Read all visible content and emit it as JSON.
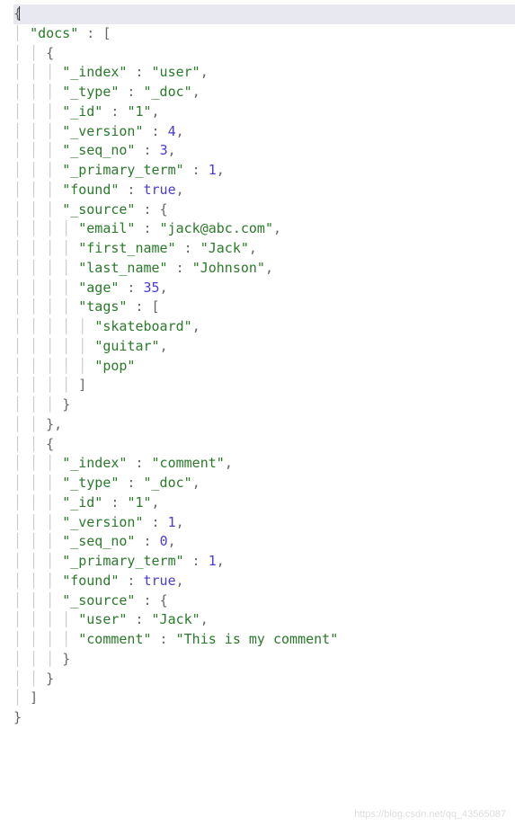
{
  "tokens": [
    [
      {
        "t": "{",
        "c": "brace",
        "hl": true,
        "cursor": true
      }
    ],
    [
      {
        "t": "  ",
        "c": "pad"
      },
      {
        "t": "\"docs\"",
        "c": "key"
      },
      {
        "t": " : ",
        "c": "punct"
      },
      {
        "t": "[",
        "c": "brace"
      }
    ],
    [
      {
        "t": "    ",
        "c": "pad"
      },
      {
        "t": "{",
        "c": "brace"
      }
    ],
    [
      {
        "t": "      ",
        "c": "pad"
      },
      {
        "t": "\"_index\"",
        "c": "key"
      },
      {
        "t": " : ",
        "c": "punct"
      },
      {
        "t": "\"user\"",
        "c": "str"
      },
      {
        "t": ",",
        "c": "punct"
      }
    ],
    [
      {
        "t": "      ",
        "c": "pad"
      },
      {
        "t": "\"_type\"",
        "c": "key"
      },
      {
        "t": " : ",
        "c": "punct"
      },
      {
        "t": "\"_doc\"",
        "c": "str"
      },
      {
        "t": ",",
        "c": "punct"
      }
    ],
    [
      {
        "t": "      ",
        "c": "pad"
      },
      {
        "t": "\"_id\"",
        "c": "key"
      },
      {
        "t": " : ",
        "c": "punct"
      },
      {
        "t": "\"1\"",
        "c": "str"
      },
      {
        "t": ",",
        "c": "punct"
      }
    ],
    [
      {
        "t": "      ",
        "c": "pad"
      },
      {
        "t": "\"_version\"",
        "c": "key"
      },
      {
        "t": " : ",
        "c": "punct"
      },
      {
        "t": "4",
        "c": "num"
      },
      {
        "t": ",",
        "c": "punct"
      }
    ],
    [
      {
        "t": "      ",
        "c": "pad"
      },
      {
        "t": "\"_seq_no\"",
        "c": "key"
      },
      {
        "t": " : ",
        "c": "punct"
      },
      {
        "t": "3",
        "c": "num"
      },
      {
        "t": ",",
        "c": "punct"
      }
    ],
    [
      {
        "t": "      ",
        "c": "pad"
      },
      {
        "t": "\"_primary_term\"",
        "c": "key"
      },
      {
        "t": " : ",
        "c": "punct"
      },
      {
        "t": "1",
        "c": "num"
      },
      {
        "t": ",",
        "c": "punct"
      }
    ],
    [
      {
        "t": "      ",
        "c": "pad"
      },
      {
        "t": "\"found\"",
        "c": "key"
      },
      {
        "t": " : ",
        "c": "punct"
      },
      {
        "t": "true",
        "c": "bool"
      },
      {
        "t": ",",
        "c": "punct"
      }
    ],
    [
      {
        "t": "      ",
        "c": "pad"
      },
      {
        "t": "\"_source\"",
        "c": "key"
      },
      {
        "t": " : ",
        "c": "punct"
      },
      {
        "t": "{",
        "c": "brace"
      }
    ],
    [
      {
        "t": "        ",
        "c": "pad"
      },
      {
        "t": "\"email\"",
        "c": "key"
      },
      {
        "t": " : ",
        "c": "punct"
      },
      {
        "t": "\"jack@abc.com\"",
        "c": "str"
      },
      {
        "t": ",",
        "c": "punct"
      }
    ],
    [
      {
        "t": "        ",
        "c": "pad"
      },
      {
        "t": "\"first_name\"",
        "c": "key"
      },
      {
        "t": " : ",
        "c": "punct"
      },
      {
        "t": "\"Jack\"",
        "c": "str"
      },
      {
        "t": ",",
        "c": "punct"
      }
    ],
    [
      {
        "t": "        ",
        "c": "pad"
      },
      {
        "t": "\"last_name\"",
        "c": "key"
      },
      {
        "t": " : ",
        "c": "punct"
      },
      {
        "t": "\"Johnson\"",
        "c": "str"
      },
      {
        "t": ",",
        "c": "punct"
      }
    ],
    [
      {
        "t": "        ",
        "c": "pad"
      },
      {
        "t": "\"age\"",
        "c": "key"
      },
      {
        "t": " : ",
        "c": "punct"
      },
      {
        "t": "35",
        "c": "num"
      },
      {
        "t": ",",
        "c": "punct"
      }
    ],
    [
      {
        "t": "        ",
        "c": "pad"
      },
      {
        "t": "\"tags\"",
        "c": "key"
      },
      {
        "t": " : ",
        "c": "punct"
      },
      {
        "t": "[",
        "c": "brace"
      }
    ],
    [
      {
        "t": "          ",
        "c": "pad"
      },
      {
        "t": "\"skateboard\"",
        "c": "str"
      },
      {
        "t": ",",
        "c": "punct"
      }
    ],
    [
      {
        "t": "          ",
        "c": "pad"
      },
      {
        "t": "\"guitar\"",
        "c": "str"
      },
      {
        "t": ",",
        "c": "punct"
      }
    ],
    [
      {
        "t": "          ",
        "c": "pad"
      },
      {
        "t": "\"pop\"",
        "c": "str"
      }
    ],
    [
      {
        "t": "        ",
        "c": "pad"
      },
      {
        "t": "]",
        "c": "brace"
      }
    ],
    [
      {
        "t": "      ",
        "c": "pad"
      },
      {
        "t": "}",
        "c": "brace"
      }
    ],
    [
      {
        "t": "    ",
        "c": "pad"
      },
      {
        "t": "}",
        "c": "brace"
      },
      {
        "t": ",",
        "c": "punct"
      }
    ],
    [
      {
        "t": "    ",
        "c": "pad"
      },
      {
        "t": "{",
        "c": "brace"
      }
    ],
    [
      {
        "t": "      ",
        "c": "pad"
      },
      {
        "t": "\"_index\"",
        "c": "key"
      },
      {
        "t": " : ",
        "c": "punct"
      },
      {
        "t": "\"comment\"",
        "c": "str"
      },
      {
        "t": ",",
        "c": "punct"
      }
    ],
    [
      {
        "t": "      ",
        "c": "pad"
      },
      {
        "t": "\"_type\"",
        "c": "key"
      },
      {
        "t": " : ",
        "c": "punct"
      },
      {
        "t": "\"_doc\"",
        "c": "str"
      },
      {
        "t": ",",
        "c": "punct"
      }
    ],
    [
      {
        "t": "      ",
        "c": "pad"
      },
      {
        "t": "\"_id\"",
        "c": "key"
      },
      {
        "t": " : ",
        "c": "punct"
      },
      {
        "t": "\"1\"",
        "c": "str"
      },
      {
        "t": ",",
        "c": "punct"
      }
    ],
    [
      {
        "t": "      ",
        "c": "pad"
      },
      {
        "t": "\"_version\"",
        "c": "key"
      },
      {
        "t": " : ",
        "c": "punct"
      },
      {
        "t": "1",
        "c": "num"
      },
      {
        "t": ",",
        "c": "punct"
      }
    ],
    [
      {
        "t": "      ",
        "c": "pad"
      },
      {
        "t": "\"_seq_no\"",
        "c": "key"
      },
      {
        "t": " : ",
        "c": "punct"
      },
      {
        "t": "0",
        "c": "num"
      },
      {
        "t": ",",
        "c": "punct"
      }
    ],
    [
      {
        "t": "      ",
        "c": "pad"
      },
      {
        "t": "\"_primary_term\"",
        "c": "key"
      },
      {
        "t": " : ",
        "c": "punct"
      },
      {
        "t": "1",
        "c": "num"
      },
      {
        "t": ",",
        "c": "punct"
      }
    ],
    [
      {
        "t": "      ",
        "c": "pad"
      },
      {
        "t": "\"found\"",
        "c": "key"
      },
      {
        "t": " : ",
        "c": "punct"
      },
      {
        "t": "true",
        "c": "bool"
      },
      {
        "t": ",",
        "c": "punct"
      }
    ],
    [
      {
        "t": "      ",
        "c": "pad"
      },
      {
        "t": "\"_source\"",
        "c": "key"
      },
      {
        "t": " : ",
        "c": "punct"
      },
      {
        "t": "{",
        "c": "brace"
      }
    ],
    [
      {
        "t": "        ",
        "c": "pad"
      },
      {
        "t": "\"user\"",
        "c": "key"
      },
      {
        "t": " : ",
        "c": "punct"
      },
      {
        "t": "\"Jack\"",
        "c": "str"
      },
      {
        "t": ",",
        "c": "punct"
      }
    ],
    [
      {
        "t": "        ",
        "c": "pad"
      },
      {
        "t": "\"comment\"",
        "c": "key"
      },
      {
        "t": " : ",
        "c": "punct"
      },
      {
        "t": "\"This is my comment\"",
        "c": "str"
      }
    ],
    [
      {
        "t": "      ",
        "c": "pad"
      },
      {
        "t": "}",
        "c": "brace"
      }
    ],
    [
      {
        "t": "    ",
        "c": "pad"
      },
      {
        "t": "}",
        "c": "brace"
      }
    ],
    [
      {
        "t": "  ",
        "c": "pad"
      },
      {
        "t": "]",
        "c": "brace"
      }
    ],
    [
      {
        "t": "}",
        "c": "brace"
      }
    ]
  ],
  "watermark": "https://blog.csdn.net/qq_43565087"
}
